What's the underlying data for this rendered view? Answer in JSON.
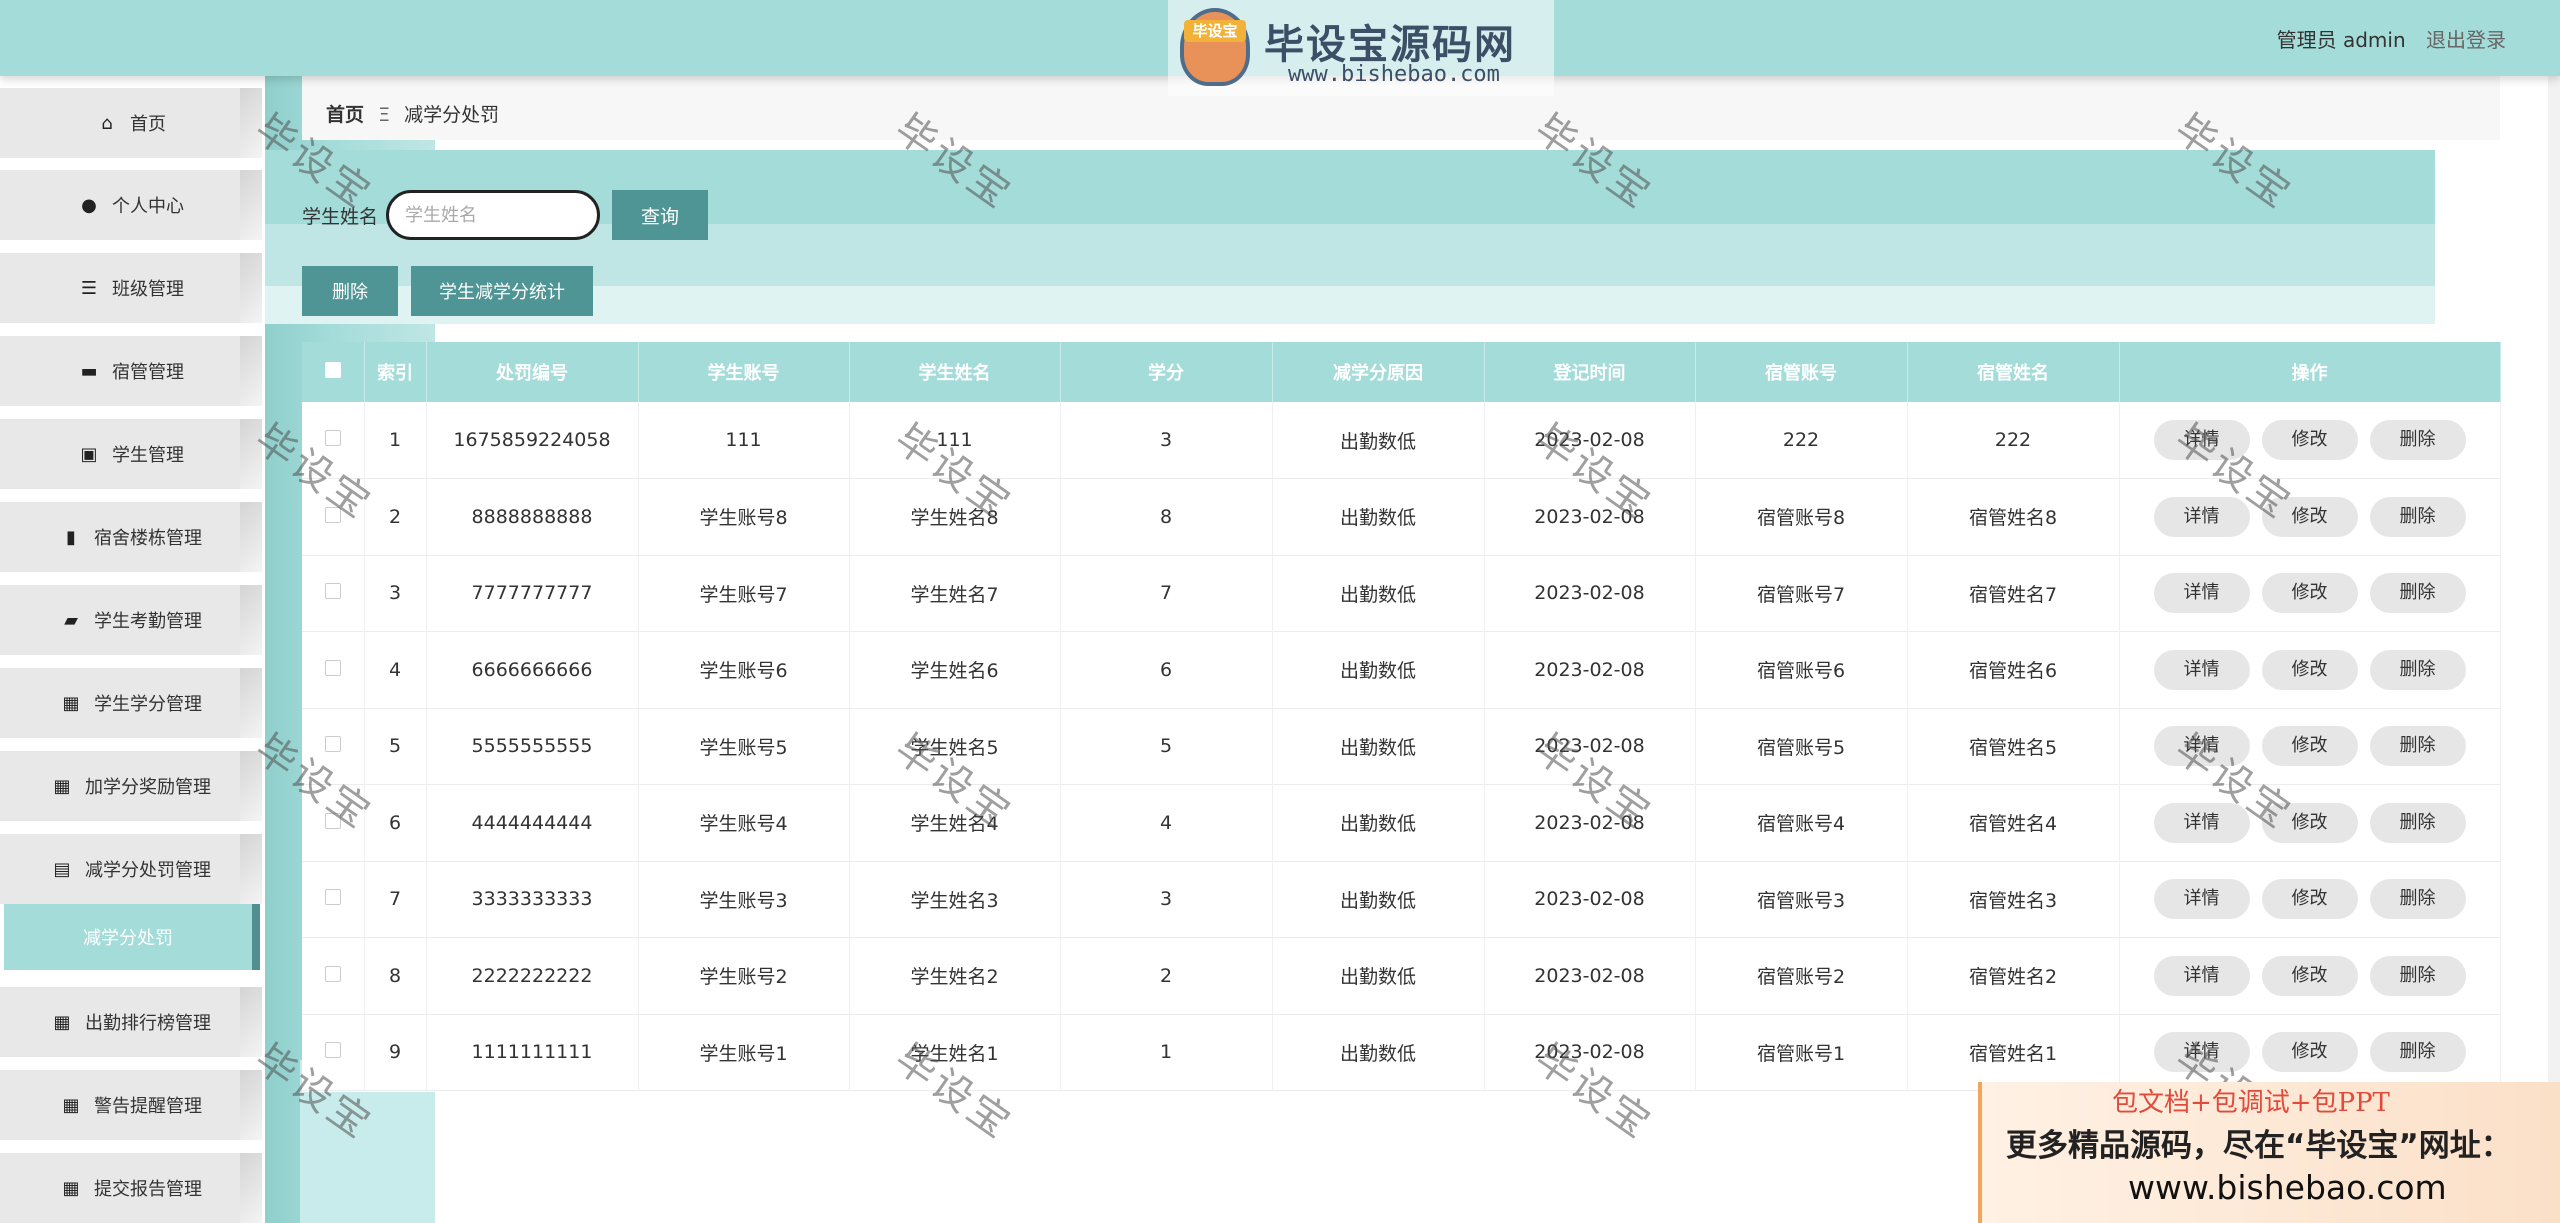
{
  "logo": {
    "badge": "毕设宝",
    "title": "毕设宝源码网",
    "url": "www.bishebao.com"
  },
  "header": {
    "user": "管理员 admin",
    "logout": "退出登录"
  },
  "sidebar": {
    "items": [
      {
        "label": "首页",
        "icon": "home-icon",
        "glyph": "⌂"
      },
      {
        "label": "个人中心",
        "icon": "user-icon",
        "glyph": "●"
      },
      {
        "label": "班级管理",
        "icon": "sliders-icon",
        "glyph": "☰"
      },
      {
        "label": "宿管管理",
        "icon": "inbox-icon",
        "glyph": "▬"
      },
      {
        "label": "学生管理",
        "icon": "clipboard-icon",
        "glyph": "▣"
      },
      {
        "label": "宿舍楼栋管理",
        "icon": "bar-chart-icon",
        "glyph": "▮"
      },
      {
        "label": "学生考勤管理",
        "icon": "briefcase-icon",
        "glyph": "▰"
      },
      {
        "label": "学生学分管理",
        "icon": "grid-icon",
        "glyph": "▦"
      },
      {
        "label": "加学分奖励管理",
        "icon": "grid-icon",
        "glyph": "▦"
      },
      {
        "label": "减学分处罚管理",
        "icon": "clipboard-icon",
        "glyph": "▤"
      },
      {
        "label": "出勤排行榜管理",
        "icon": "grid-icon",
        "glyph": "▦"
      },
      {
        "label": "警告提醒管理",
        "icon": "grid-icon",
        "glyph": "▦"
      },
      {
        "label": "提交报告管理",
        "icon": "grid-icon",
        "glyph": "▦"
      }
    ],
    "active_sub": "减学分处罚"
  },
  "breadcrumb": {
    "home": "首页",
    "sep": "Ξ",
    "current": "减学分处罚"
  },
  "search": {
    "label": "学生姓名",
    "placeholder": "学生姓名",
    "value": "",
    "query_button": "查询"
  },
  "actions": {
    "delete": "删除",
    "stat": "学生减学分统计"
  },
  "table": {
    "columns": [
      "索引",
      "处罚编号",
      "学生账号",
      "学生姓名",
      "学分",
      "减学分原因",
      "登记时间",
      "宿管账号",
      "宿管姓名",
      "操作"
    ],
    "rows": [
      {
        "index": "1",
        "code": "1675859224058",
        "account": "111",
        "name": "111",
        "credit": "3",
        "reason": "出勤数低",
        "time": "2023-02-08",
        "dorm_account": "222",
        "dorm_name": "222"
      },
      {
        "index": "2",
        "code": "8888888888",
        "account": "学生账号8",
        "name": "学生姓名8",
        "credit": "8",
        "reason": "出勤数低",
        "time": "2023-02-08",
        "dorm_account": "宿管账号8",
        "dorm_name": "宿管姓名8"
      },
      {
        "index": "3",
        "code": "7777777777",
        "account": "学生账号7",
        "name": "学生姓名7",
        "credit": "7",
        "reason": "出勤数低",
        "time": "2023-02-08",
        "dorm_account": "宿管账号7",
        "dorm_name": "宿管姓名7"
      },
      {
        "index": "4",
        "code": "6666666666",
        "account": "学生账号6",
        "name": "学生姓名6",
        "credit": "6",
        "reason": "出勤数低",
        "time": "2023-02-08",
        "dorm_account": "宿管账号6",
        "dorm_name": "宿管姓名6"
      },
      {
        "index": "5",
        "code": "5555555555",
        "account": "学生账号5",
        "name": "学生姓名5",
        "credit": "5",
        "reason": "出勤数低",
        "time": "2023-02-08",
        "dorm_account": "宿管账号5",
        "dorm_name": "宿管姓名5"
      },
      {
        "index": "6",
        "code": "4444444444",
        "account": "学生账号4",
        "name": "学生姓名4",
        "credit": "4",
        "reason": "出勤数低",
        "time": "2023-02-08",
        "dorm_account": "宿管账号4",
        "dorm_name": "宿管姓名4"
      },
      {
        "index": "7",
        "code": "3333333333",
        "account": "学生账号3",
        "name": "学生姓名3",
        "credit": "3",
        "reason": "出勤数低",
        "time": "2023-02-08",
        "dorm_account": "宿管账号3",
        "dorm_name": "宿管姓名3"
      },
      {
        "index": "8",
        "code": "2222222222",
        "account": "学生账号2",
        "name": "学生姓名2",
        "credit": "2",
        "reason": "出勤数低",
        "time": "2023-02-08",
        "dorm_account": "宿管账号2",
        "dorm_name": "宿管姓名2"
      },
      {
        "index": "9",
        "code": "1111111111",
        "account": "学生账号1",
        "name": "学生姓名1",
        "credit": "1",
        "reason": "出勤数低",
        "time": "2023-02-08",
        "dorm_account": "宿管账号1",
        "dorm_name": "宿管姓名1"
      }
    ],
    "row_actions": {
      "detail": "详情",
      "edit": "修改",
      "delete": "删除"
    }
  },
  "watermark": "毕设宝",
  "ad": {
    "line1": "包文档+包调试+包PPT",
    "line2": "更多精品源码，尽在“毕设宝”网址：",
    "line3": "www.bishebao.com"
  },
  "colors": {
    "accent": "#a4dcd9",
    "button": "#4f9596",
    "active_border": "#4f8f90"
  }
}
